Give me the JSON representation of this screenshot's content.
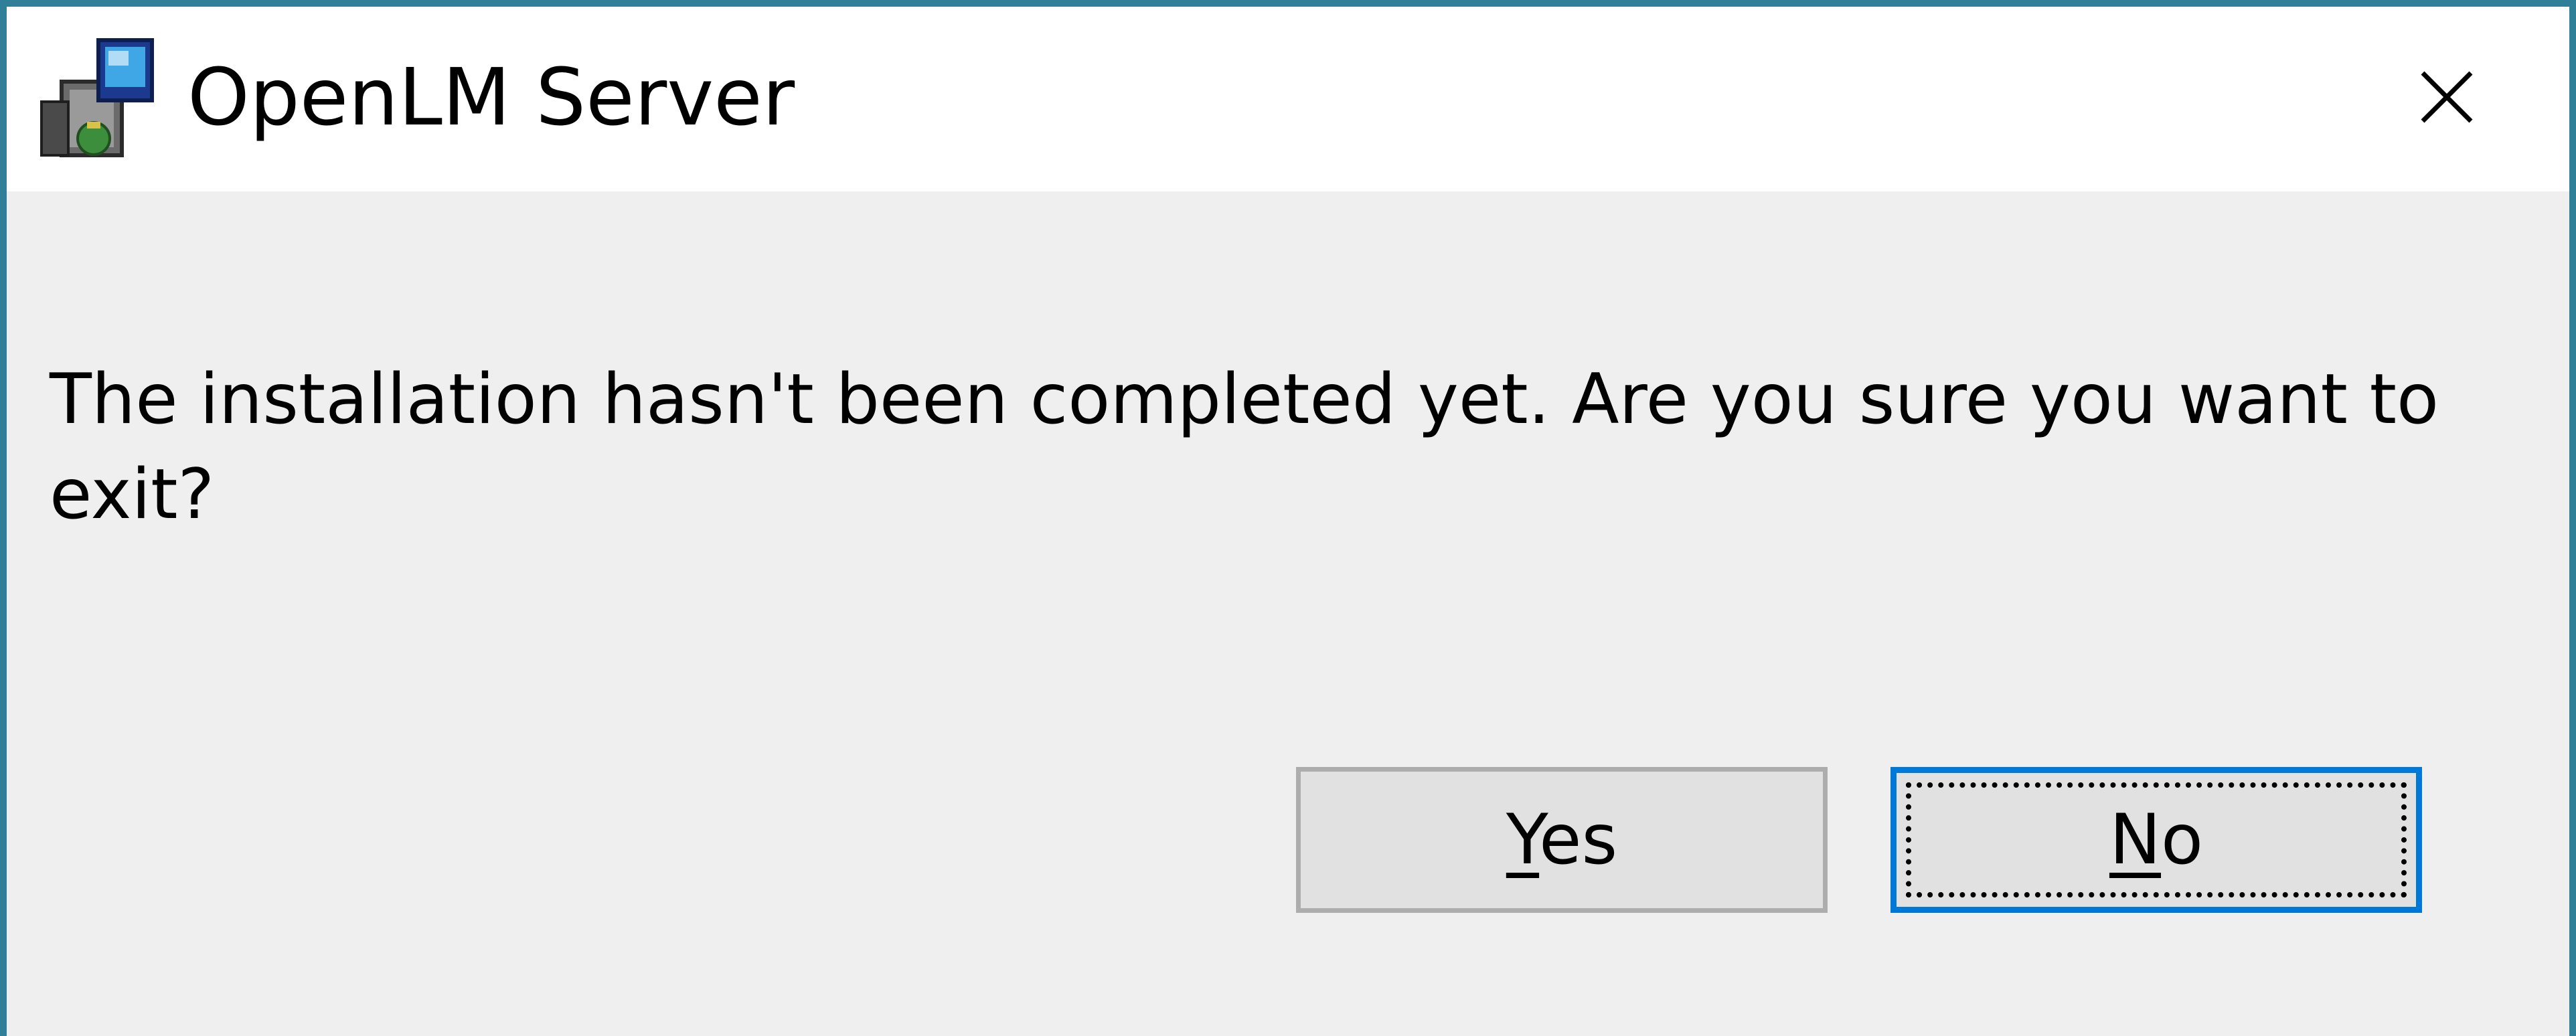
{
  "window": {
    "title": "OpenLM Server",
    "app_icon": "installer-package-icon",
    "close_icon": "close-icon",
    "border_color": "#2e7f97"
  },
  "message": {
    "text": "The installation hasn't been completed yet. Are you sure you want to exit?"
  },
  "buttons": {
    "yes": {
      "mnemonic": "Y",
      "rest": "es",
      "focused": false
    },
    "no": {
      "mnemonic": "N",
      "rest": "o",
      "focused": true,
      "focus_color": "#0078d7"
    }
  }
}
